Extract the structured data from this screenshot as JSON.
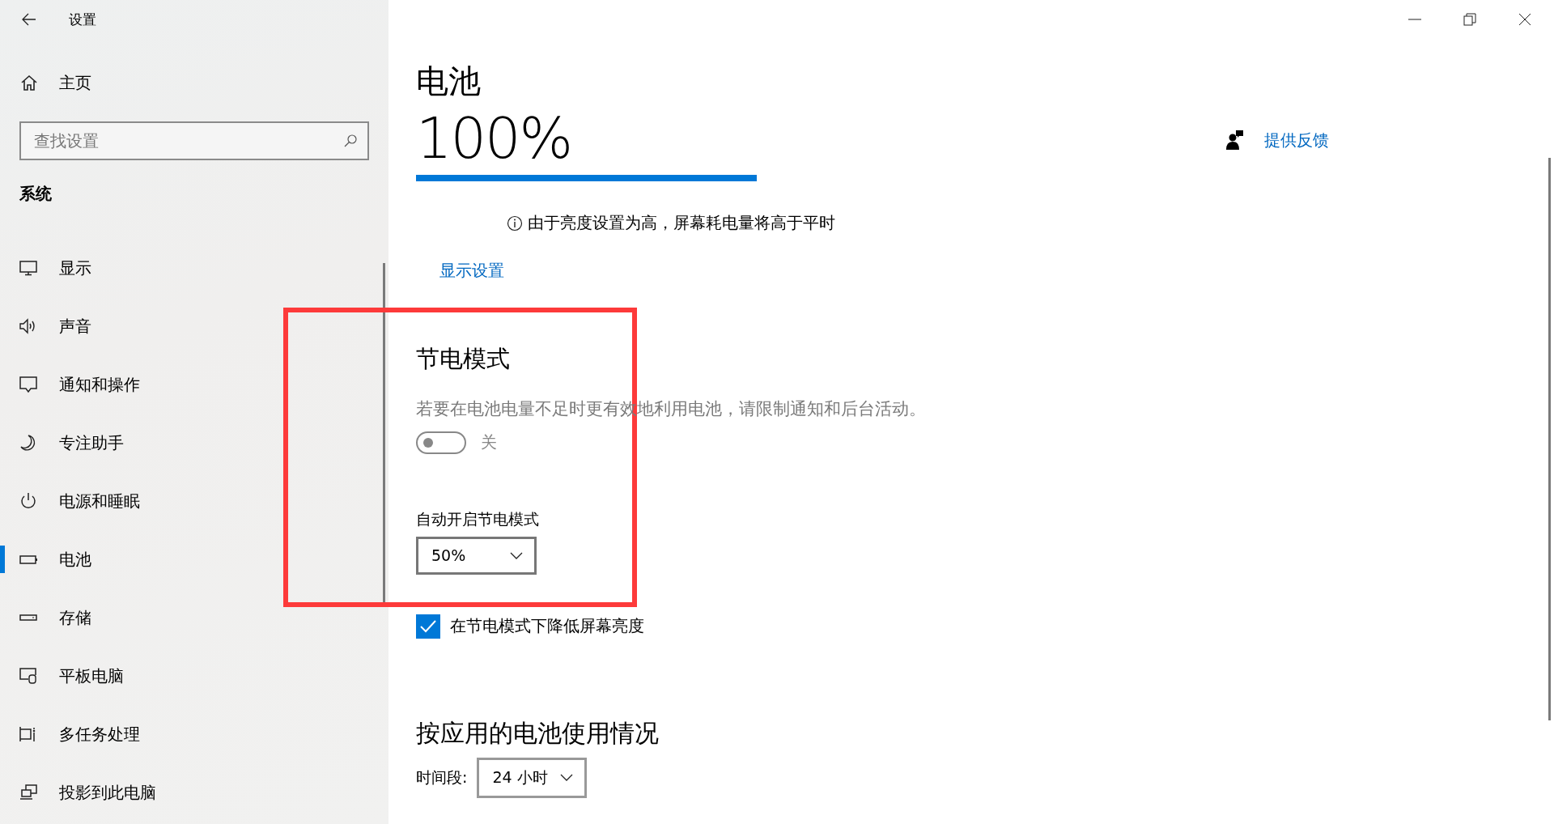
{
  "window": {
    "title": "设置"
  },
  "sidebar": {
    "home": "主页",
    "search": {
      "placeholder": "查找设置"
    },
    "section": "系统",
    "items": [
      {
        "label": "显示",
        "selected": false
      },
      {
        "label": "声音",
        "selected": false
      },
      {
        "label": "通知和操作",
        "selected": false
      },
      {
        "label": "专注助手",
        "selected": false
      },
      {
        "label": "电源和睡眠",
        "selected": false
      },
      {
        "label": "电池",
        "selected": true
      },
      {
        "label": "存储",
        "selected": false
      },
      {
        "label": "平板电脑",
        "selected": false
      },
      {
        "label": "多任务处理",
        "selected": false
      },
      {
        "label": "投影到此电脑",
        "selected": false
      }
    ]
  },
  "page": {
    "title": "电池",
    "percent": "100%",
    "level": 1.0,
    "notice": "由于亮度设置为高，屏幕耗电量将高于平时",
    "display_link": "显示设置",
    "feedback": "提供反馈"
  },
  "saver": {
    "title": "节电模式",
    "description": "若要在电池电量不足时更有效地利用电池，请限制通知和后台活动。",
    "toggle": {
      "on": false,
      "label": "关"
    },
    "auto_label": "自动开启节电模式",
    "auto_value": "50%",
    "dim": {
      "label": "在节电模式下降低屏幕亮度",
      "checked": true
    }
  },
  "usage": {
    "title": "按应用的电池使用情况",
    "period_label": "时间段:",
    "period_value": "24 小时"
  }
}
